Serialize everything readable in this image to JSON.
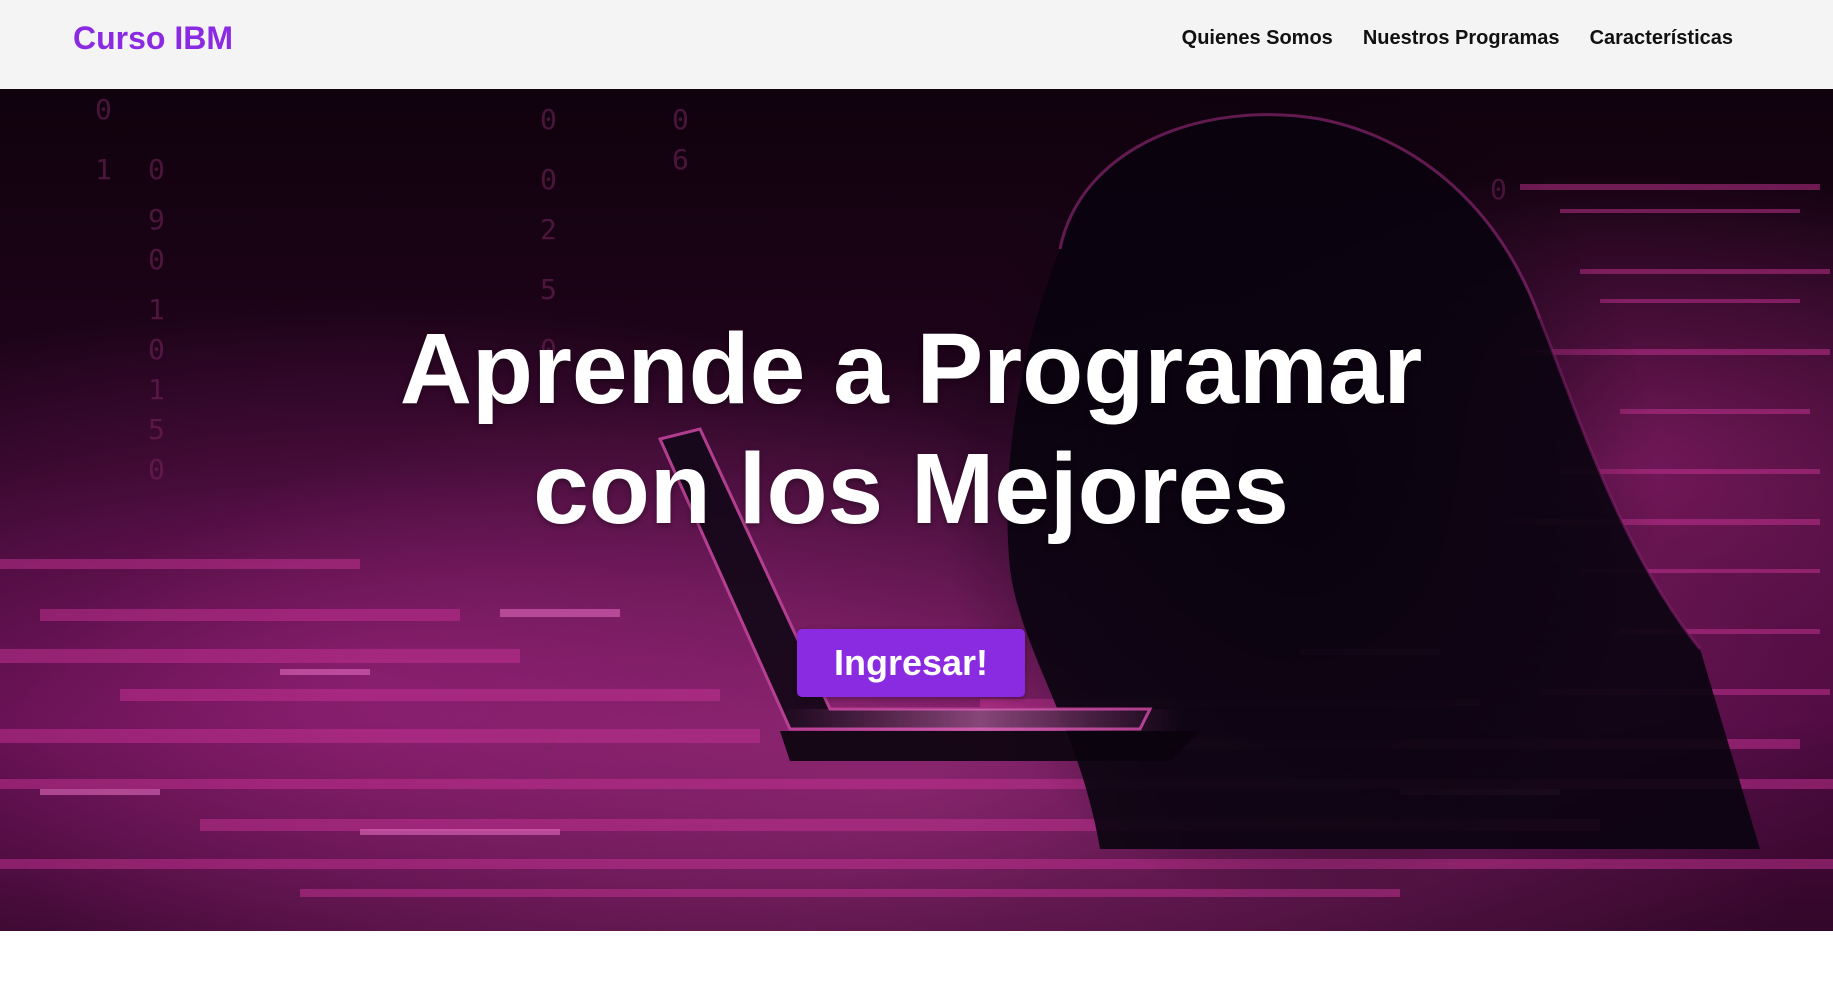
{
  "navbar": {
    "brand": "Curso IBM",
    "links": [
      {
        "label": "Quienes Somos"
      },
      {
        "label": "Nuestros Programas"
      },
      {
        "label": "Características"
      }
    ]
  },
  "hero": {
    "title_line_1": "Aprende a Programar",
    "title_line_2": "con los Mejores",
    "cta_label": "Ingresar!",
    "background_image": "hooded-hacker-laptop-digital-code-background"
  },
  "colors": {
    "brand": "#8a2be2",
    "navbar_bg": "#f4f4f4",
    "hero_overlay": "#b0208c"
  }
}
